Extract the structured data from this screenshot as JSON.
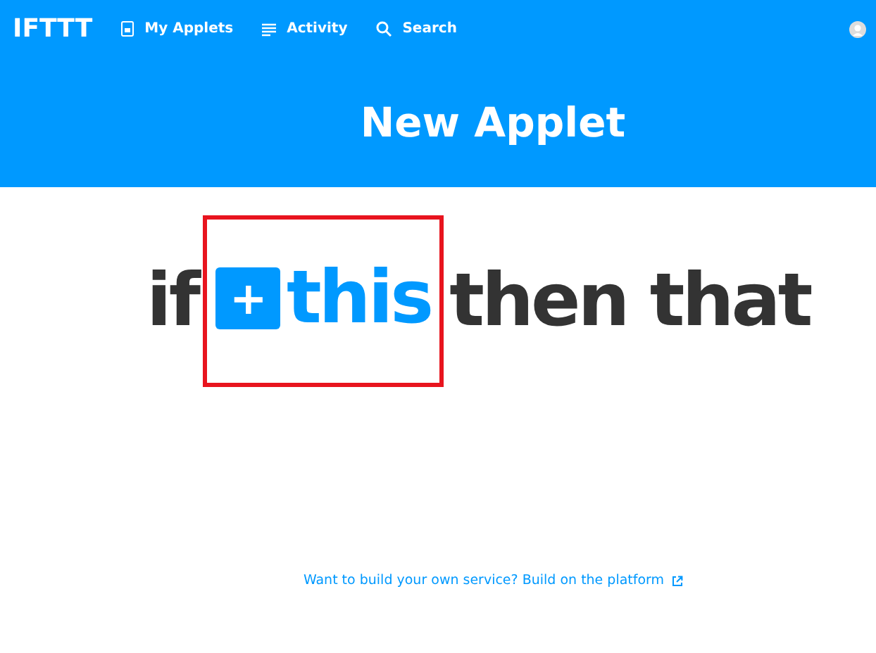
{
  "nav": {
    "logo": "IFTTT",
    "items": [
      {
        "kind": "applets",
        "label": "My Applets"
      },
      {
        "kind": "activity",
        "label": "Activity"
      },
      {
        "kind": "search",
        "label": "Search"
      }
    ]
  },
  "header": {
    "title": "New Applet"
  },
  "statement": {
    "if_word": "if",
    "add_symbol": "+",
    "this_word": "this",
    "then_word": "then that",
    "highlighted": true
  },
  "footer": {
    "link": "Want to build your own service? Build on the platform"
  }
}
